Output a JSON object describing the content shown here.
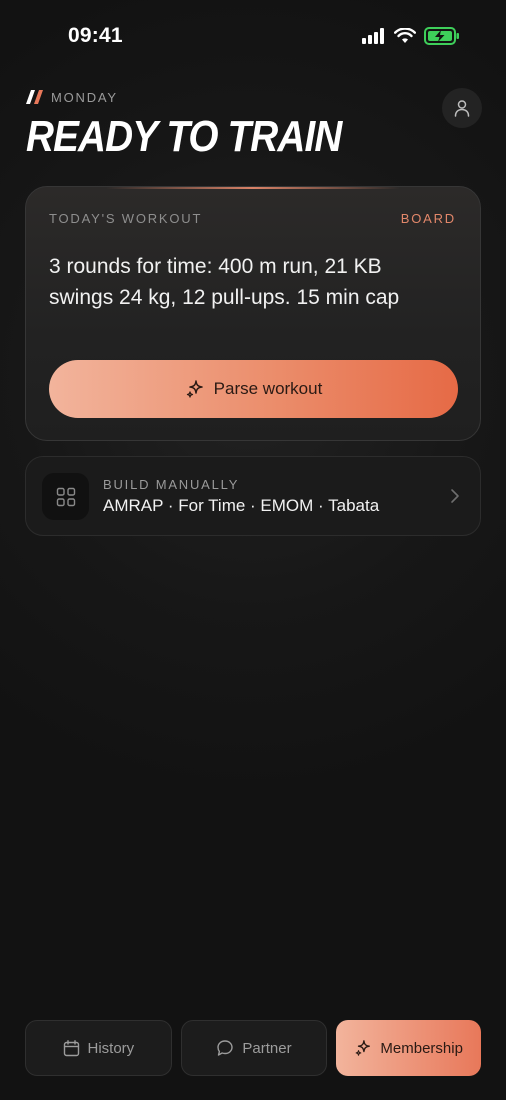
{
  "status_bar": {
    "time": "09:41"
  },
  "header": {
    "day": "MONDAY",
    "title": "READY TO TRAIN"
  },
  "workout_card": {
    "label": "TODAY'S WORKOUT",
    "link": "BOARD",
    "text": "3 rounds for time: 400 m run, 21 KB swings 24 kg, 12 pull-ups. 15 min cap",
    "parse_button": "Parse workout"
  },
  "manual": {
    "label": "BUILD MANUALLY",
    "types": "AMRAP · For Time · EMOM · Tabata"
  },
  "tabs": [
    {
      "label": "History",
      "icon": "calendar-icon"
    },
    {
      "label": "Partner",
      "icon": "chat-bubble-icon"
    },
    {
      "label": "Membership",
      "icon": "sparkle-icon",
      "active": true
    }
  ],
  "colors": {
    "accent": "#e8785a",
    "accent_light": "#f2b49c",
    "background": "#171717"
  }
}
